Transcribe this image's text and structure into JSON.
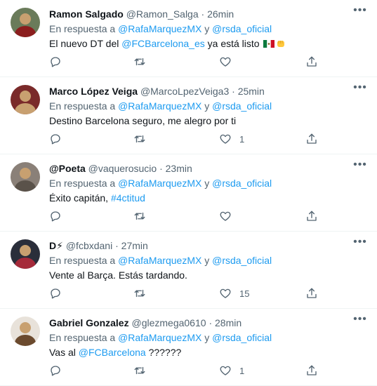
{
  "common": {
    "reply_prefix": "En respuesta a",
    "reply_joiner": "y",
    "reply_user1": "@RafaMarquezMX",
    "reply_user2": "@rsda_oficial",
    "separator": "·",
    "more_glyph": "•••"
  },
  "tweets": [
    {
      "name": "Ramon Salgado",
      "handle": "@Ramon_Salga",
      "time": "26min",
      "text_before": "El nuevo DT del ",
      "link": "@FCBarcelona_es",
      "text_after": " ya está listo ",
      "emojis": [
        "mexico-flag",
        "fist"
      ],
      "replies": "",
      "retweets": "",
      "likes": "",
      "avatar_colors": [
        "#6a7b5a",
        "#8b1e1e"
      ]
    },
    {
      "name": "Marco López Veiga",
      "handle": "@MarcoLpezVeiga3",
      "time": "25min",
      "text_before": "Destino Barcelona seguro, me alegro por ti",
      "link": "",
      "text_after": "",
      "replies": "",
      "retweets": "",
      "likes": "1",
      "avatar_colors": [
        "#7a2a2a",
        "#c8a070"
      ]
    },
    {
      "name": "@Poeta",
      "handle": "@vaquerosucio",
      "time": "23min",
      "text_before": "Éxito capitán, ",
      "link": "#4ctitud",
      "text_after": "",
      "replies": "",
      "retweets": "",
      "likes": "",
      "avatar_colors": [
        "#8a8078",
        "#5a524a"
      ]
    },
    {
      "name": "D⚡",
      "handle": "@fcbxdani",
      "time": "27min",
      "text_before": "Vente al Barça. Estás tardando.",
      "link": "",
      "text_after": "",
      "replies": "",
      "retweets": "",
      "likes": "15",
      "avatar_colors": [
        "#2a2e3a",
        "#a52a3a"
      ]
    },
    {
      "name": "Gabriel Gonzalez",
      "handle": "@glezmega0610",
      "time": "28min",
      "text_before": "Vas al ",
      "link": "@FCBarcelona",
      "text_after": " ??????",
      "replies": "",
      "retweets": "",
      "likes": "1",
      "avatar_colors": [
        "#e8e2da",
        "#6b4a2e"
      ]
    }
  ],
  "icons": {
    "reply": "reply-icon",
    "retweet": "retweet-icon",
    "like": "heart-icon",
    "share": "share-icon",
    "more": "more-icon"
  },
  "colors": {
    "link": "#1d9bf0",
    "muted": "#536471",
    "text": "#0f1419",
    "divider": "#eff3f4"
  }
}
